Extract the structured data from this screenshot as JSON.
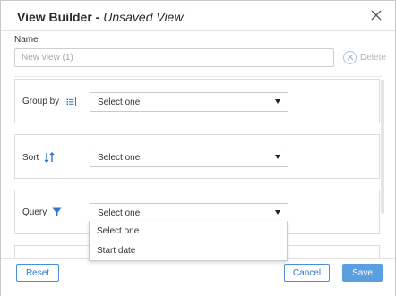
{
  "dialog": {
    "title": "View Builder -",
    "subtitle": "Unsaved View"
  },
  "name_field": {
    "label": "Name",
    "placeholder": "New view (1)",
    "delete_label": "Delete"
  },
  "sections": {
    "group_by": {
      "label": "Group by",
      "icon": "list-icon",
      "value": "Select one"
    },
    "sort": {
      "label": "Sort",
      "icon": "sort-arrows-icon",
      "value": "Select one"
    },
    "query": {
      "label": "Query",
      "icon": "filter-icon",
      "value": "Select one"
    }
  },
  "query_dropdown": {
    "options": [
      "Select one",
      "Start date"
    ]
  },
  "footer": {
    "reset_label": "Reset",
    "cancel_label": "Cancel",
    "save_label": "Save"
  },
  "colors": {
    "accent": "#2f78c4",
    "primary_button": "#5c9fe0"
  }
}
